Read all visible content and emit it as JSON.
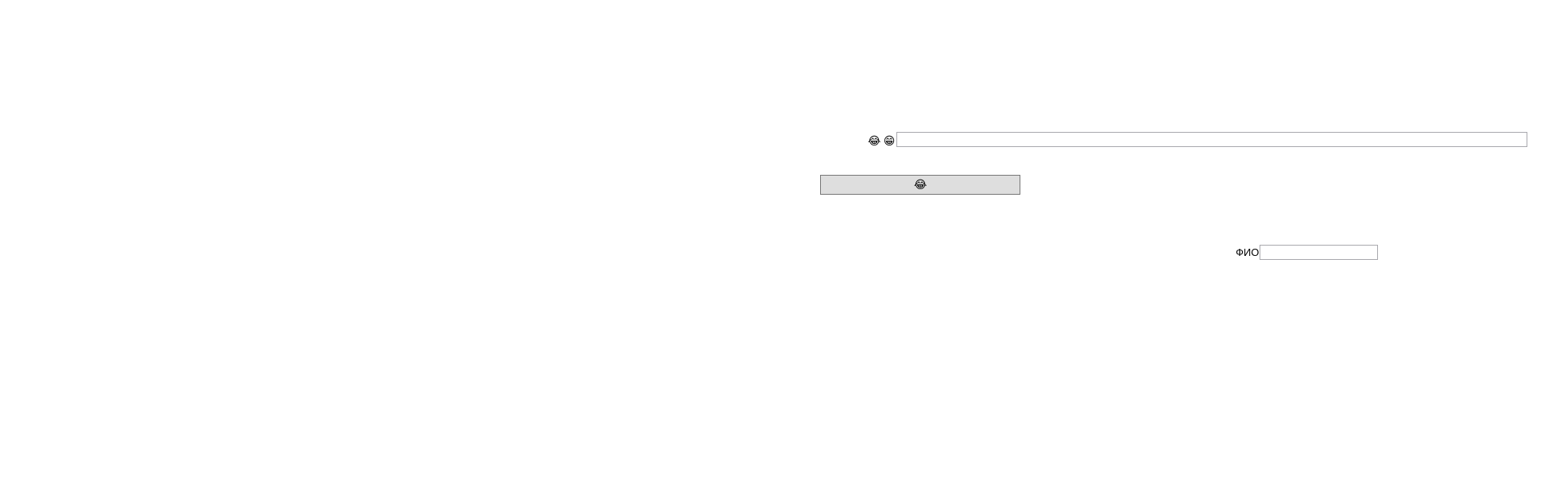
{
  "emoji_row": {
    "emoji_1": "😂",
    "emoji_2": "😁",
    "text_input_value": ""
  },
  "emoji_button": {
    "label": "😂"
  },
  "fio_field": {
    "label": "ФИО",
    "value": ""
  }
}
